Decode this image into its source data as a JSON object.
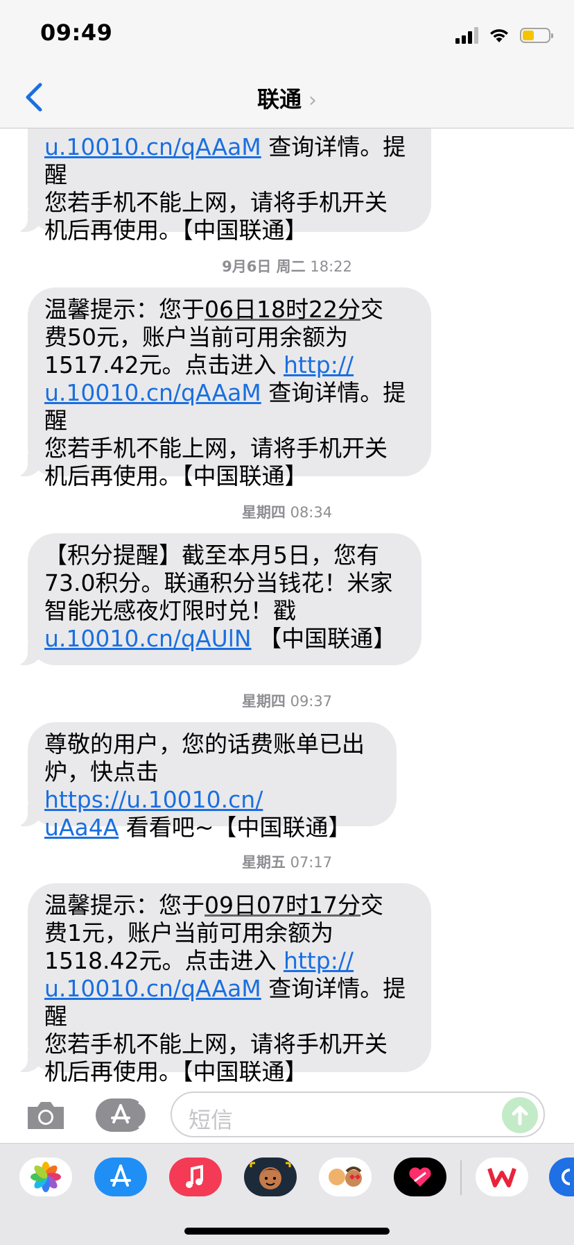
{
  "status": {
    "time": "09:49",
    "battery_level": 0.4
  },
  "nav": {
    "title": "联通",
    "chevron": "›",
    "back_icon": "chevron-left-icon"
  },
  "messages": [
    {
      "lines": [
        [
          "u.10010.cn/qAAaM",
          " 查询详情。提醒"
        ],
        [
          "您若手机不能上网，请将手机开关"
        ],
        [
          "机后再使用。【中国联通】"
        ]
      ]
    },
    {
      "timestamp_day": "9月6日 周二",
      "timestamp_time": "18:22",
      "lines": [
        "温馨提示：您于",
        "06日18时22分",
        "交",
        "费50元，账户当前可用余额为",
        "1517.42元。点击进入 ",
        "http://",
        "u.10010.cn/qAAaM",
        " 查询详情。提醒",
        "您若手机不能上网，请将手机开关",
        "机后再使用。【中国联通】"
      ]
    },
    {
      "timestamp_day": "星期四",
      "timestamp_time": "08:34",
      "lines": [
        "【积分提醒】截至本月5日，您有",
        "73.0积分。联通积分当钱花！米家",
        "智能光感夜灯限时兑！戳",
        "u.10010.cn/qAUlN",
        " 【中国联通】"
      ]
    },
    {
      "timestamp_day": "星期四",
      "timestamp_time": "09:37",
      "lines": [
        "尊敬的用户，您的话费账单已出",
        "炉，快点击 ",
        "https://u.10010.cn/",
        "uAa4A",
        " 看看吧~【中国联通】"
      ]
    },
    {
      "timestamp_day": "星期五",
      "timestamp_time": "07:17",
      "lines": [
        "温馨提示：您于",
        "09日07时17分",
        "交",
        "费1元，账户当前可用余额为",
        "1518.42元。点击进入 ",
        "http://",
        "u.10010.cn/qAAaM",
        " 查询详情。提醒",
        "您若手机不能上网，请将手机开关",
        "机后再使用。【中国联通】"
      ]
    }
  ],
  "input": {
    "placeholder": "短信"
  },
  "tray": {
    "apps": [
      "photos-icon",
      "app-store-icon",
      "music-icon",
      "memoji-icon",
      "memoji-stickers-icon",
      "digital-touch-icon",
      "wps-icon",
      "more-app-icon"
    ],
    "colors": {
      "photos": "#ffffff",
      "appstore": "#1f8ef5",
      "music": "#f43a55",
      "fitness": "#000000",
      "wps": "#ffffff",
      "accent": "#1a6fe0"
    }
  }
}
